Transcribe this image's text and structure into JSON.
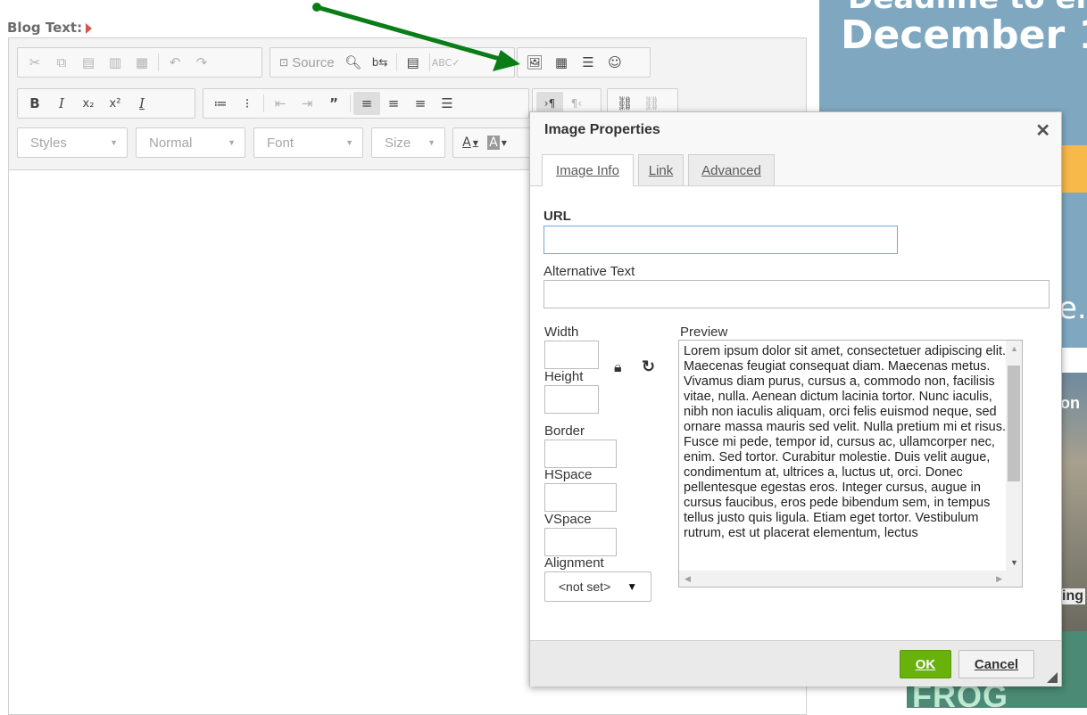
{
  "page": {
    "blog_label": "Blog Text:"
  },
  "toolbar": {
    "source_label": "Source",
    "styles_combo": "Styles",
    "format_combo": "Normal",
    "font_combo": "Font",
    "size_combo": "Size",
    "text_color_label": "A",
    "bg_color_label": "A"
  },
  "ad": {
    "line1": "Deadline to en",
    "line2": "December 1",
    "fragment_dot": "e.",
    "fragment_mid": "on",
    "fragment_ing": "ing",
    "fragment_frog": "FROG"
  },
  "dialog": {
    "title": "Image Properties",
    "close_glyph": "✕",
    "tabs": [
      {
        "label": "Image Info"
      },
      {
        "label": "Link"
      },
      {
        "label": "Advanced"
      }
    ],
    "url_label": "URL",
    "url_value": "",
    "alt_label": "Alternative Text",
    "alt_value": "",
    "width_label": "Width",
    "height_label": "Height",
    "border_label": "Border",
    "hspace_label": "HSpace",
    "vspace_label": "VSpace",
    "alignment_label": "Alignment",
    "alignment_value": "<not set>",
    "preview_label": "Preview",
    "preview_text": "Lorem ipsum dolor sit amet, consectetuer adipiscing elit. Maecenas feugiat consequat diam. Maecenas metus. Vivamus diam purus, cursus a, commodo non, facilisis vitae, nulla. Aenean dictum lacinia tortor. Nunc iaculis, nibh non iaculis aliquam, orci felis euismod neque, sed ornare massa mauris sed velit. Nulla pretium mi et risus. Fusce mi pede, tempor id, cursus ac, ullamcorper nec, enim. Sed tortor. Curabitur molestie. Duis velit augue, condimentum at, ultrices a, luctus ut, orci. Donec pellentesque egestas eros. Integer cursus, augue in cursus faucibus, eros pede bibendum sem, in tempus tellus justo quis ligula. Etiam eget tortor. Vestibulum rutrum, est ut placerat elementum, lectus",
    "ok_label": "OK",
    "cancel_label": "Cancel"
  },
  "colors": {
    "ok_green": "#69b10b",
    "arrow_green": "#0a7d16",
    "ad_blue": "#7fa8c0",
    "url_focus": "#66aadd"
  }
}
